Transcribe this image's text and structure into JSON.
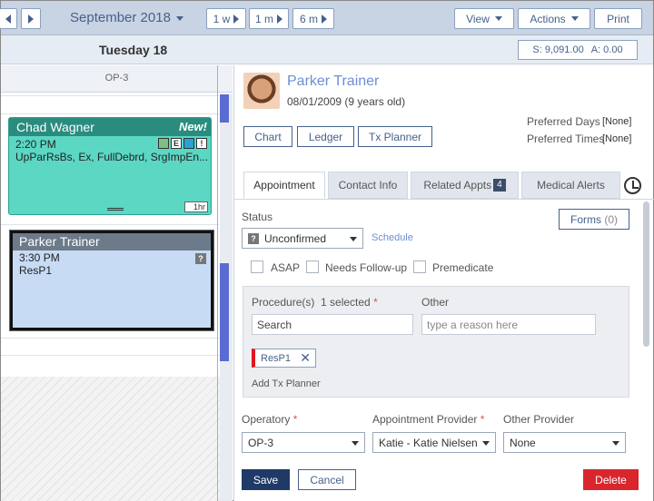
{
  "toolbar": {
    "prev_label": "",
    "next_label": "",
    "month": "September 2018",
    "jump_1w": "1 w",
    "jump_1m": "1 m",
    "jump_6m": "6 m",
    "view": "View",
    "actions": "Actions",
    "print": "Print"
  },
  "day_header": "Tuesday 18",
  "balances": {
    "s": "S: 9,091.00",
    "a": "A: 0.00"
  },
  "calendar": {
    "column": "OP-3",
    "appointments": [
      {
        "patient": "Chad Wagner",
        "new_label": "New!",
        "time": "2:20 PM",
        "procedures": "UpParRsBs, Ex, FullDebrd, SrgImpEn...",
        "duration": "1hr",
        "icon_e": "E",
        "icon_alert": "!"
      },
      {
        "patient": "Parker Trainer",
        "time": "3:30 PM",
        "procedures": "ResP1",
        "icon_q": "?"
      }
    ]
  },
  "patient": {
    "name": "Parker Trainer",
    "dob": "08/01/2009 (9 years old)",
    "buttons": [
      "Chart",
      "Ledger",
      "Tx Planner"
    ],
    "preferred_days_label": "Preferred Days",
    "preferred_days_value": "[None]",
    "preferred_times_label": "Preferred Times",
    "preferred_times_value": "[None]"
  },
  "tabs": [
    {
      "label": "Appointment",
      "badge": ""
    },
    {
      "label": "Contact Info",
      "badge": ""
    },
    {
      "label": "Related Appts",
      "badge": "4"
    },
    {
      "label": "Medical Alerts",
      "badge": ""
    }
  ],
  "appointment": {
    "status_label": "Status",
    "status_value": "Unconfirmed",
    "status_icon": "?",
    "schedule_link": "Schedule",
    "forms_label": "Forms",
    "forms_count": "(0)",
    "checkboxes": [
      "ASAP",
      "Needs Follow-up",
      "Premedicate"
    ],
    "procedures_label": "Procedure(s)",
    "procedures_selected": "1 selected",
    "required_mark": "*",
    "other_label": "Other",
    "search_placeholder": "Search",
    "other_placeholder": "type a reason here",
    "chip": "ResP1",
    "add_tx_planner": "Add Tx Planner",
    "operatory_label": "Operatory",
    "operatory_value": "OP-3",
    "provider_label": "Appointment Provider",
    "provider_value": "Katie - Katie Nielsen",
    "other_provider_label": "Other Provider",
    "other_provider_value": "None",
    "save": "Save",
    "cancel": "Cancel",
    "delete": "Delete"
  },
  "colors": {
    "accent": "#46618a",
    "primary_button": "#1f3a66",
    "delete_button": "#d9262d",
    "new_appt": "#5bd7c4"
  }
}
